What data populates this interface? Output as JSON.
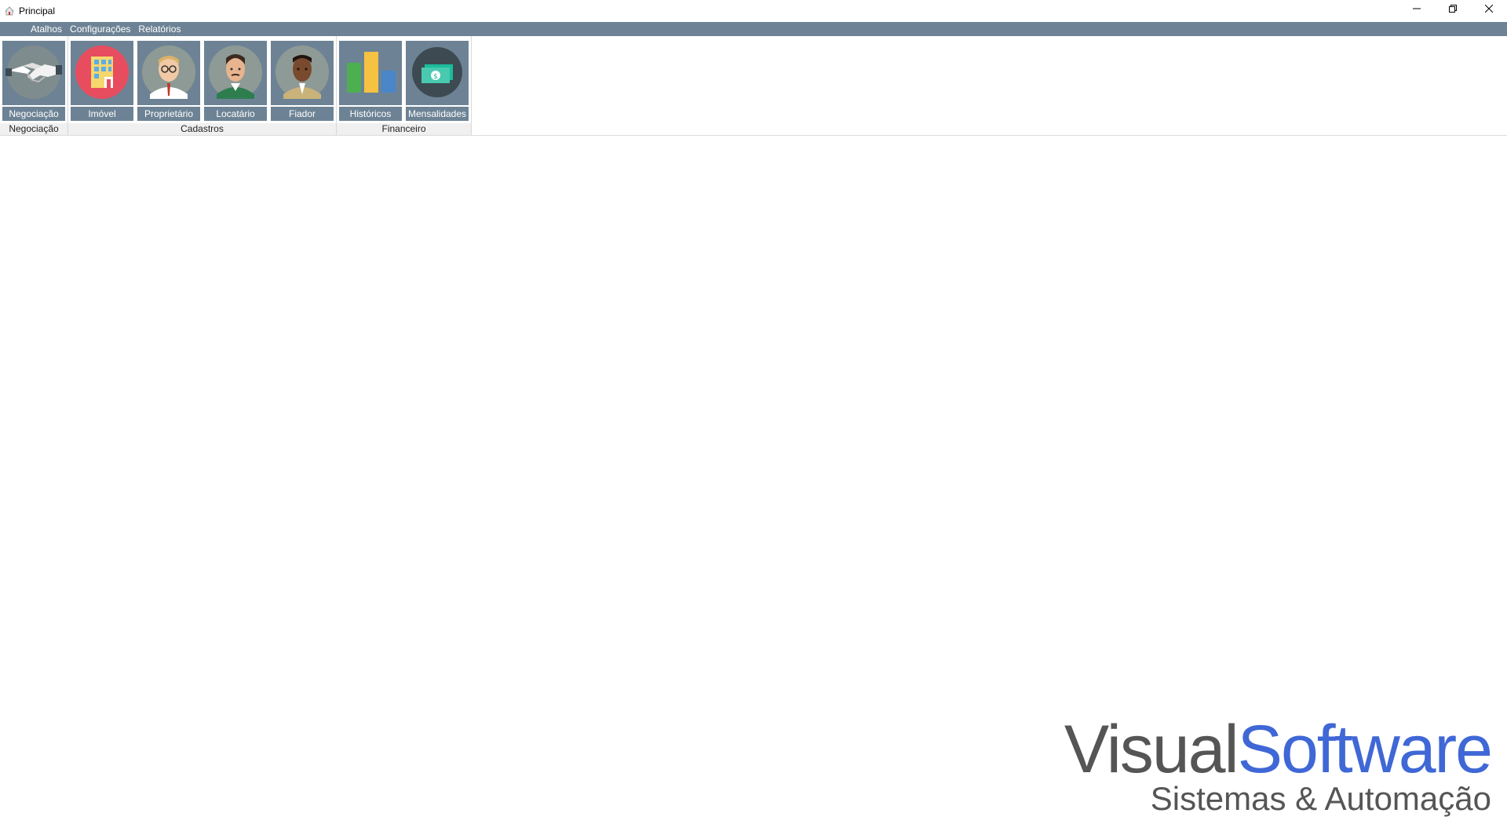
{
  "window": {
    "title": "Principal",
    "controls": {
      "minimize": "minimize-icon",
      "restore": "restore-icon",
      "close": "close-icon"
    }
  },
  "menu": {
    "items": [
      "Atalhos",
      "Configurações",
      "Relatórios"
    ]
  },
  "ribbon": {
    "groups": [
      {
        "label": "Negociação",
        "buttons": [
          {
            "label": "Negociação",
            "icon": "handshake-icon"
          }
        ]
      },
      {
        "label": "Cadastros",
        "buttons": [
          {
            "label": "Imóvel",
            "icon": "building-icon"
          },
          {
            "label": "Proprietário",
            "icon": "owner-avatar-icon"
          },
          {
            "label": "Locatário",
            "icon": "tenant-avatar-icon"
          },
          {
            "label": "Fiador",
            "icon": "guarantor-avatar-icon"
          }
        ]
      },
      {
        "label": "Financeiro",
        "buttons": [
          {
            "label": "Históricos",
            "icon": "bar-chart-icon"
          },
          {
            "label": "Mensalidades",
            "icon": "money-icon"
          }
        ]
      }
    ]
  },
  "logo": {
    "part1": "Visual",
    "part2": "Software",
    "subtitle": "Sistemas & Automação"
  },
  "colors": {
    "menu_bar": "#6d8395",
    "logo_gray": "#555555",
    "logo_blue": "#3f67d6"
  }
}
